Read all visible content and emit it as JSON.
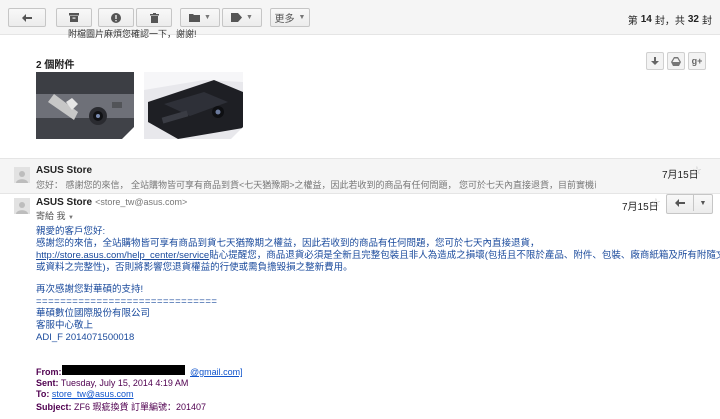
{
  "toolbar": {
    "more_label": "更多",
    "pager_prefix": "第",
    "pager_current": "14",
    "pager_mid": "封，共",
    "pager_total": "32",
    "pager_suffix": "封"
  },
  "previous_message_tail": "附檔圖片麻煩您確認一下，謝謝!",
  "attachments": {
    "title": "2 個附件"
  },
  "collapsed_message": {
    "sender": "ASUS Store",
    "snippet": "您好： 感謝您的來信， 全站購物皆可享有商品到貨<七天猶豫期>之權益，因此若收到的商品有任何問題， 您可於七天內直接退貨，目前實機已有現貨供應, 建議您重...",
    "date": "7月15日"
  },
  "expanded_message": {
    "sender": "ASUS Store",
    "sender_email": "<store_tw@asus.com>",
    "to_line": "寄給 我",
    "date": "7月15日",
    "body": {
      "greeting": "親愛的客戶您好:",
      "line1": "感謝您的來信，全站購物皆可享有商品到貨七天猶豫期之權益，因此若收到的商品有任何問題，您可於七天內直接退貨，",
      "link": "http://store.asus.com/help_center/service",
      "line2_after_link": "貼心提醒您，商品退貨必須是全新且完整包裝且非人為造成之損壞(包括且不限於產品、附件、包裝、廠商紙箱及所有附隨文件",
      "line3": "或資料之完整性)，否則將影響您退貨權益的行使或需負擔毀損之整新費用。",
      "thanks": "再次感謝您對華碩的支持!",
      "divider": "==============================",
      "company": "華碩數位國際股份有限公司",
      "department": "客服中心敬上",
      "ticket": "ADI_F 2014071500018"
    },
    "quoted": {
      "from_label": "From:",
      "from_value": "@gmail.com]",
      "sent_label": "Sent:",
      "sent_value": "Tuesday, July 15, 2014 4:19 AM",
      "to_label": "To:",
      "to_value": "store_tw@asus.com",
      "subject_label": "Subject:",
      "subject_value": "ZF6 瑕疵換貨 訂單編號：201407"
    }
  },
  "colors": {
    "link_blue": "#1a4a9c",
    "quoted_purple": "#500050",
    "toolbar_bg": "#f5f5f5"
  }
}
